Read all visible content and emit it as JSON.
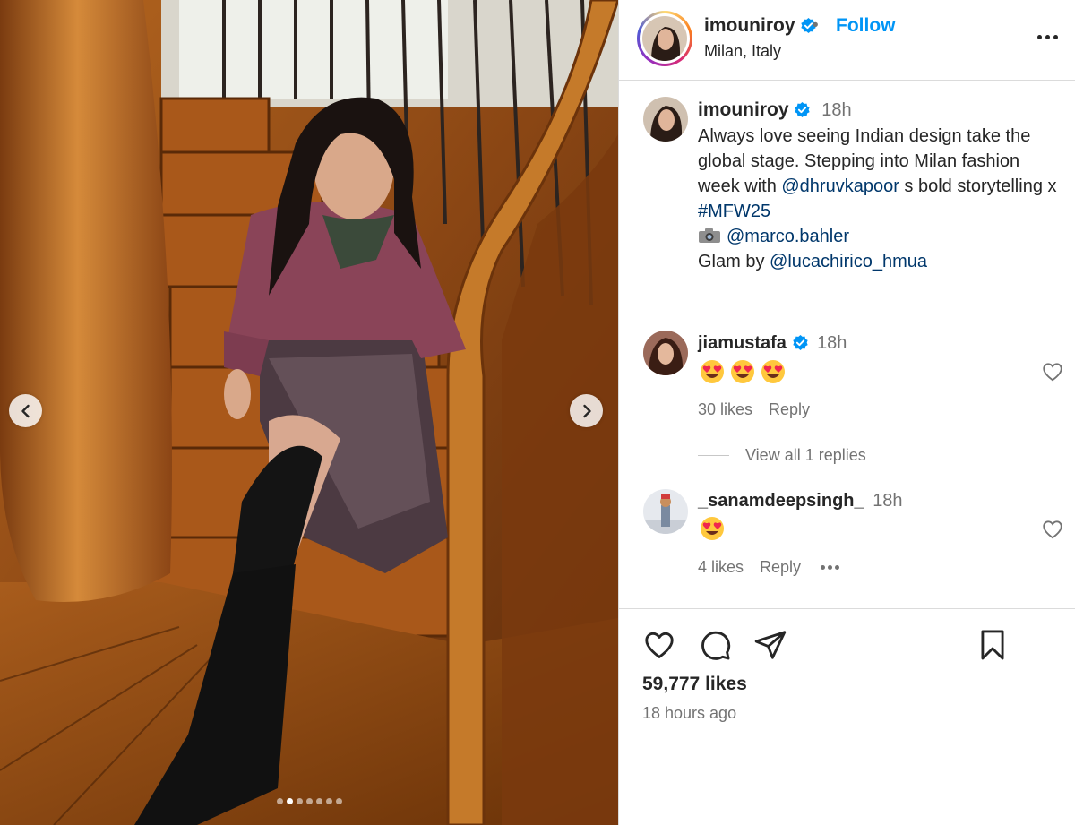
{
  "post": {
    "username": "imouniroy",
    "follow_label": "Follow",
    "separator": "•",
    "location": "Milan, Italy",
    "likes": "59,777 likes",
    "time_ago": "18 hours ago",
    "slide_index": 2,
    "slide_count": 7
  },
  "caption": {
    "username": "imouniroy",
    "time": "18h",
    "line1": "Always love seeing Indian design take the global stage. Stepping into Milan fashion week with",
    "mention1": "@dhruvkapoor",
    "line1_tail": "s bold storytelling x",
    "hashtag": "#MFW25",
    "camera_emoji": "camera-emoji",
    "mention2": "@marco.bahler",
    "glam_prefix": "Glam by",
    "mention3": "@lucachirico_hmua"
  },
  "comments": [
    {
      "username": "jiamustafa",
      "verified": true,
      "time": "18h",
      "emoji": [
        "heart-eyes-emoji",
        "heart-eyes-emoji",
        "heart-eyes-emoji"
      ],
      "likes": "30 likes",
      "reply_label": "Reply",
      "view_replies": "View all 1 replies"
    },
    {
      "username": "_sanamdeepsingh_",
      "verified": false,
      "time": "18h",
      "emoji": [
        "heart-eyes-emoji"
      ],
      "likes": "4 likes",
      "reply_label": "Reply"
    }
  ],
  "icons": {
    "like": "heart-icon",
    "comment": "comment-icon",
    "share": "send-icon",
    "save": "bookmark-icon",
    "more": "more-options-icon",
    "prev": "chevron-left-icon",
    "next": "chevron-right-icon",
    "verified": "verified-badge-icon"
  },
  "colors": {
    "link": "#0095f6",
    "mention": "#00376b",
    "text": "#262626",
    "muted": "#737373",
    "verified": "#0095f6"
  }
}
